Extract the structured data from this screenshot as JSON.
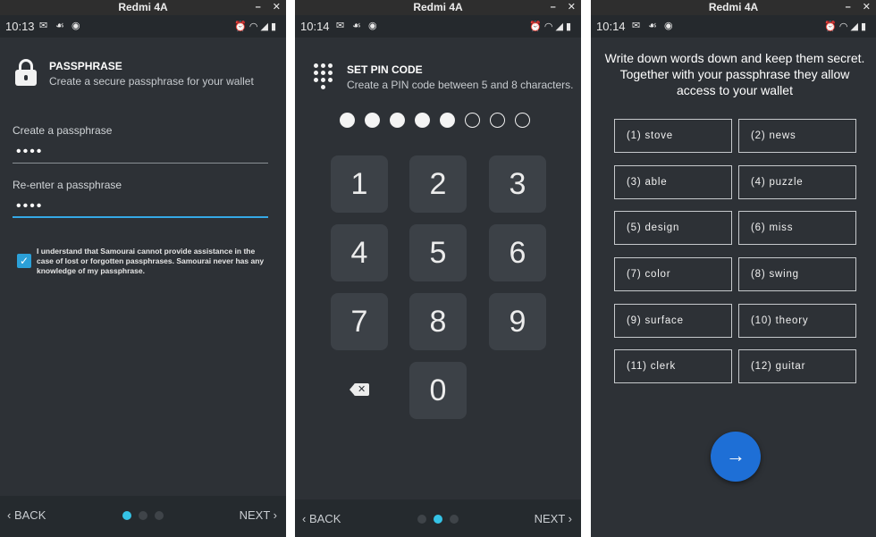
{
  "windows": [
    {
      "title": "Redmi 4A",
      "status_time": "10:13",
      "header_title": "PASSPHRASE",
      "header_subtitle": "Create a secure passphrase for your wallet",
      "field1_label": "Create a passphrase",
      "field1_value": "••••",
      "field2_label": "Re-enter a passphrase",
      "field2_value": "••••",
      "checkbox_text": "I understand that Samourai cannot provide assistance in the case of lost or forgotten passphrases. Samourai never has any knowledge of my passphrase.",
      "back_label": "BACK",
      "next_label": "NEXT"
    },
    {
      "title": "Redmi 4A",
      "status_time": "10:14",
      "header_title": "SET PIN CODE",
      "header_subtitle": "Create a PIN code between 5 and 8 characters.",
      "pin_filled": 5,
      "pin_total": 8,
      "keys": [
        "1",
        "2",
        "3",
        "4",
        "5",
        "6",
        "7",
        "8",
        "9",
        "0"
      ],
      "back_label": "BACK",
      "next_label": "NEXT"
    },
    {
      "title": "Redmi 4A",
      "status_time": "10:14",
      "instruction": "Write down words down and keep them secret. Together with your passphrase they allow access to your wallet",
      "words": [
        "(1) stove",
        "(2) news",
        "(3) able",
        "(4) puzzle",
        "(5) design",
        "(6) miss",
        "(7) color",
        "(8) swing",
        "(9) surface",
        "(10) theory",
        "(11) clerk",
        "(12) guitar"
      ]
    }
  ],
  "icons": {
    "window_minimize": "–",
    "window_close": "✕",
    "back_chevron": "‹",
    "next_chevron": "›",
    "fab_arrow": "→",
    "check": "✓"
  },
  "colors": {
    "background": "#2d3136",
    "accent": "#35c3e6",
    "fab": "#1e6fd6"
  }
}
